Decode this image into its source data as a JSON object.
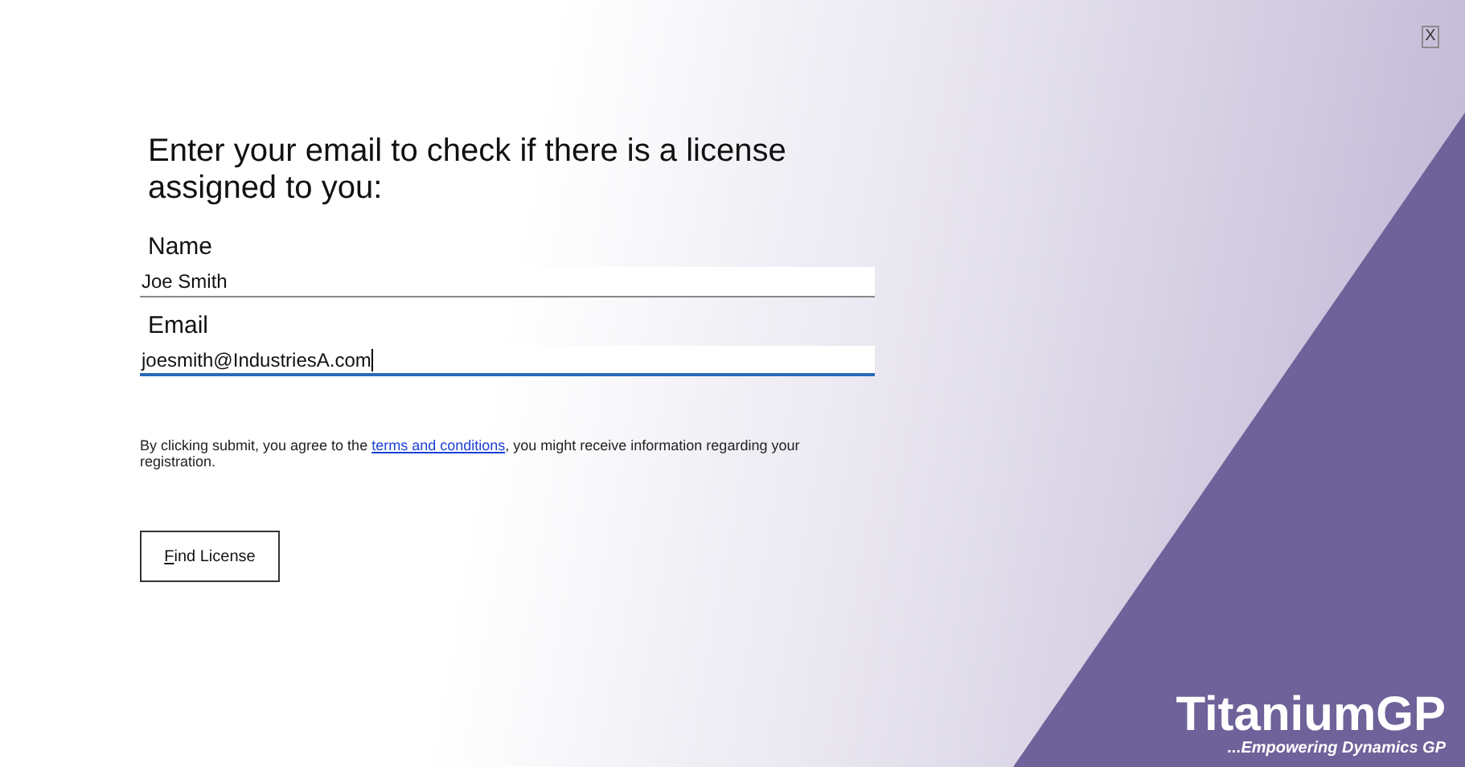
{
  "close_button": {
    "label": "X"
  },
  "heading": "Enter your email to check if there is a license assigned to you:",
  "fields": [
    {
      "label": "Name",
      "value": "Joe Smith",
      "focused": false
    },
    {
      "label": "Email",
      "value": "joesmith@IndustriesA.com",
      "focused": true
    }
  ],
  "notice": {
    "before": "By clicking submit, you agree to the ",
    "link": "terms and conditions",
    "after": ", you might receive information regarding your registration."
  },
  "submit_button": {
    "label": "Find License"
  },
  "logo": {
    "name": "TitaniumGP",
    "tagline": "...Empowering Dynamics GP"
  }
}
